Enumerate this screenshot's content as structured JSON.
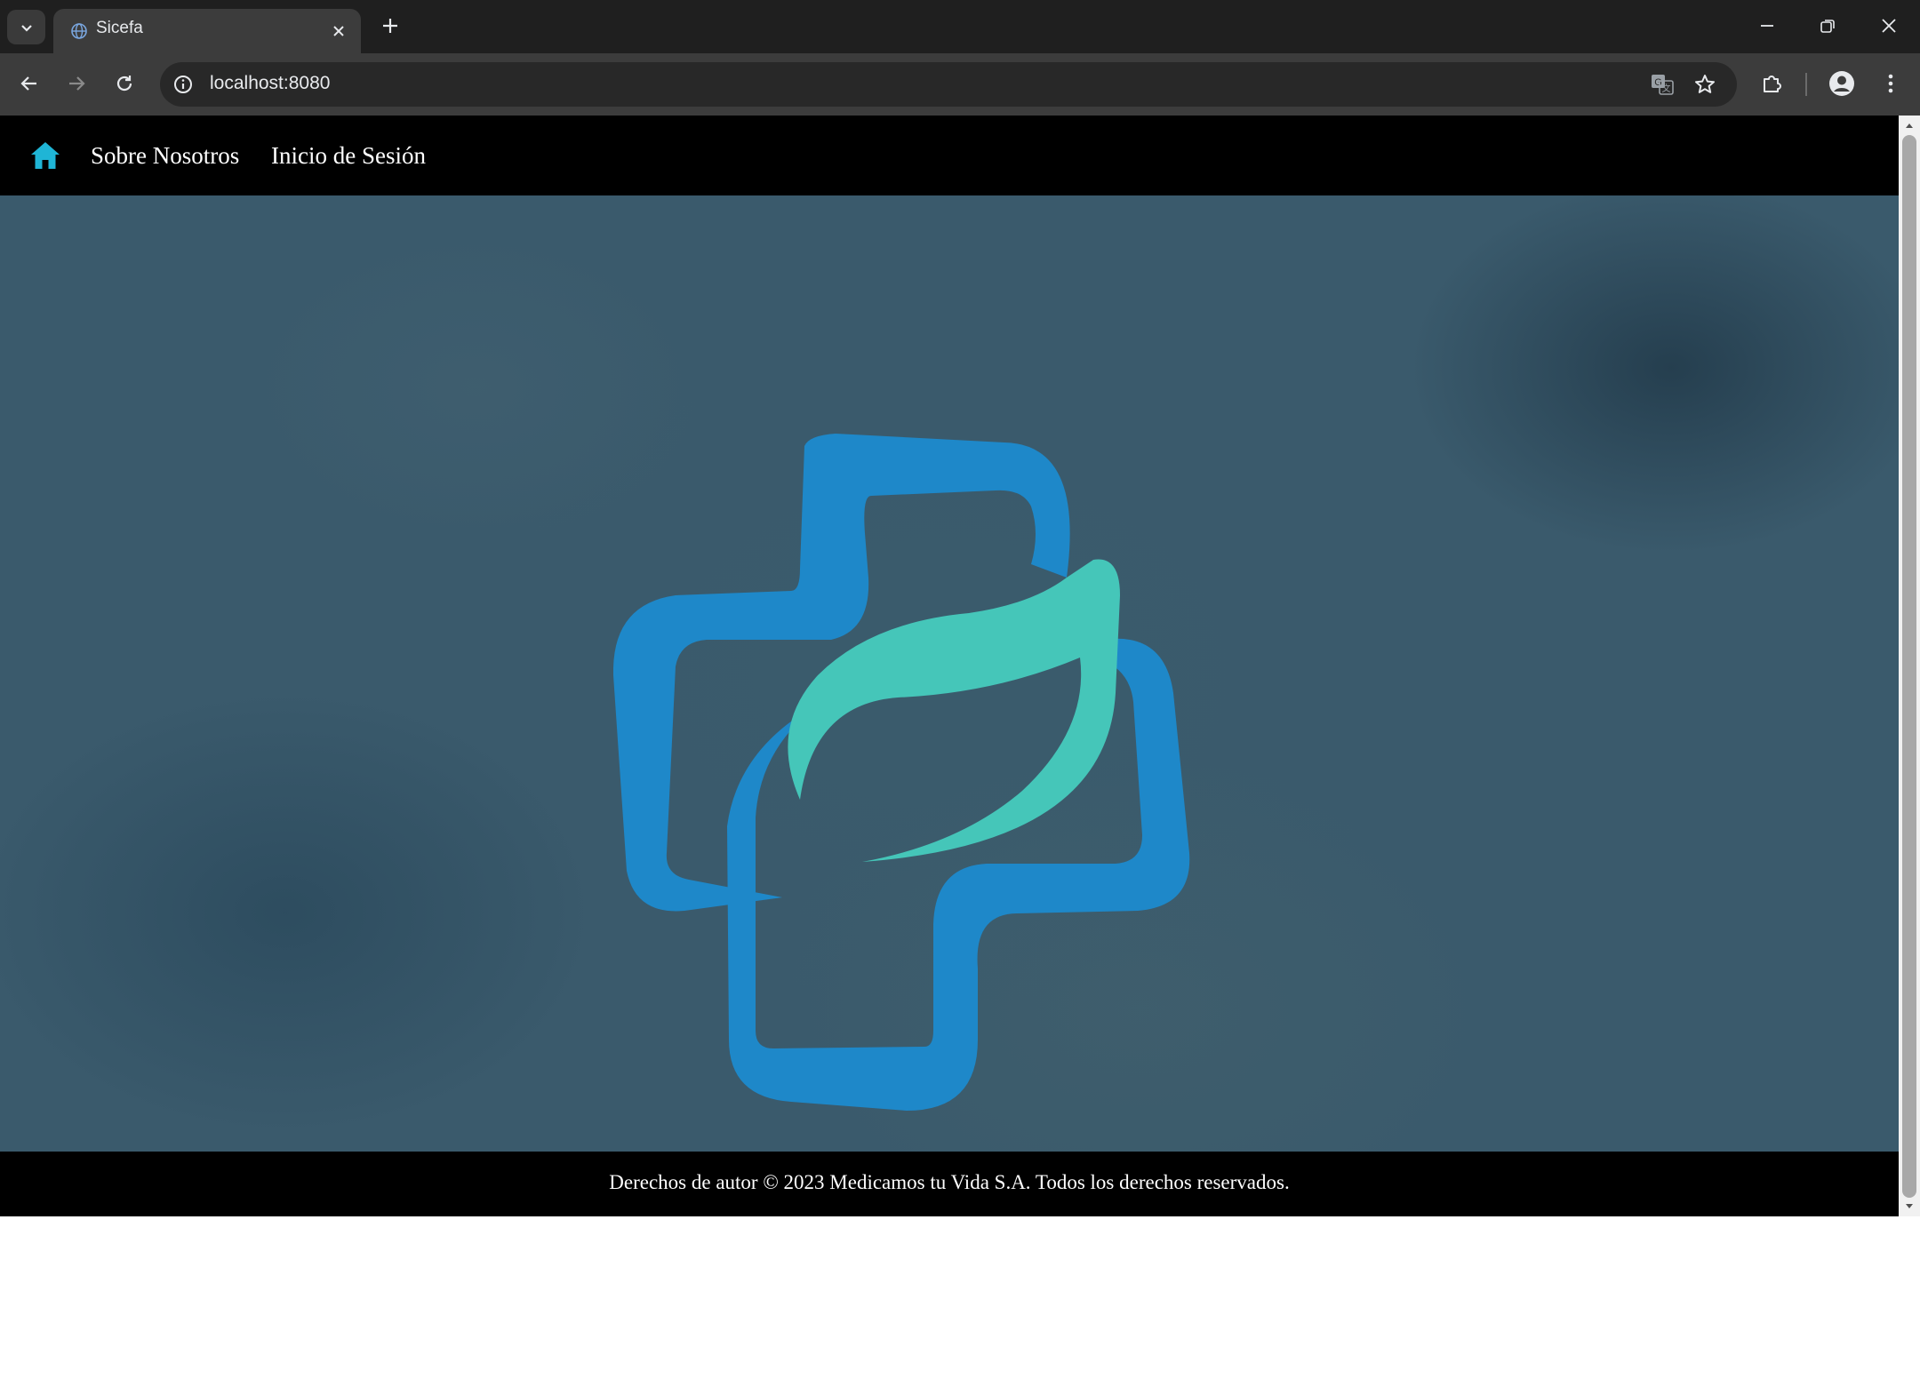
{
  "browser": {
    "tab_title": "Sicefa",
    "url": "localhost:8080"
  },
  "nav": {
    "home_icon": "home-icon",
    "links": [
      "Sobre Nosotros",
      "Inicio de Sesión"
    ]
  },
  "hero": {
    "logo": "medical-cross-leaf-logo",
    "colors": {
      "cross": "#1e88c9",
      "leaf": "#45c6b9",
      "background": "#3a5a6c"
    }
  },
  "footer": {
    "text": "Derechos de autor © 2023 Medicamos tu Vida S.A. Todos los derechos reservados."
  }
}
